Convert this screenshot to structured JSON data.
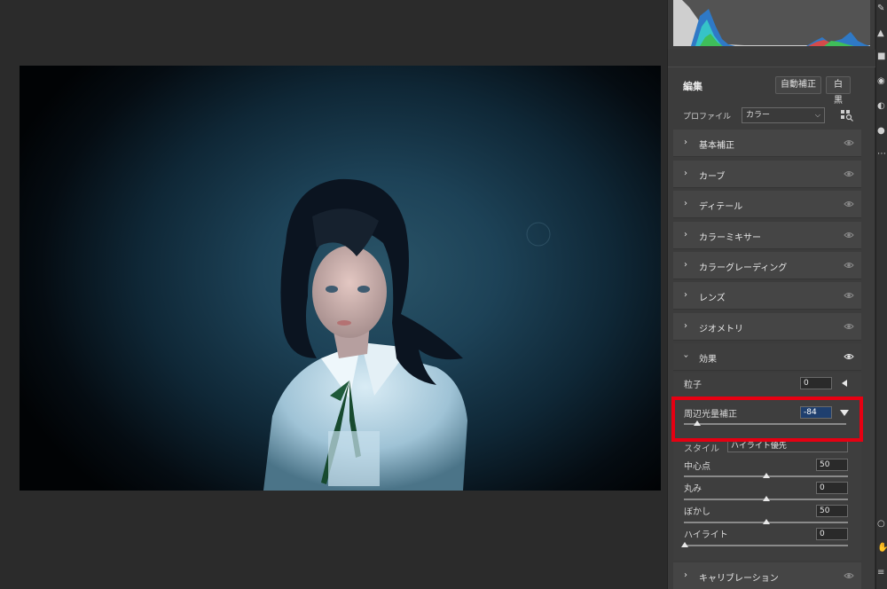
{
  "panel": {
    "edit_title": "編集",
    "auto_button": "自動補正",
    "bw_button": "白黒",
    "profile_label": "プロファイル",
    "profile_value": "カラー"
  },
  "sections": [
    {
      "label": "基本補正",
      "expanded": false
    },
    {
      "label": "カーブ",
      "expanded": false
    },
    {
      "label": "ディテール",
      "expanded": false
    },
    {
      "label": "カラーミキサー",
      "expanded": false
    },
    {
      "label": "カラーグレーディング",
      "expanded": false
    },
    {
      "label": "レンズ",
      "expanded": false
    },
    {
      "label": "ジオメトリ",
      "expanded": false
    },
    {
      "label": "効果",
      "expanded": true
    },
    {
      "label": "キャリブレーション",
      "expanded": false
    }
  ],
  "effects": {
    "grain_label": "粒子",
    "grain_value": "0",
    "vignette_label": "周辺光量補正",
    "vignette_value": "-84",
    "vignette_level": 0.08,
    "style_label": "スタイル",
    "style_value": "ハイライト優先",
    "midpoint_label": "中心点",
    "midpoint_value": "50",
    "roundness_label": "丸み",
    "roundness_value": "0",
    "feather_label": "ぼかし",
    "feather_value": "50",
    "highlights_label": "ハイライト",
    "highlights_value": "0"
  },
  "colors": {
    "highlight_border": "#e60012",
    "panel_bg": "#3c3c3c",
    "canvas_bg": "#2b2b2b"
  }
}
